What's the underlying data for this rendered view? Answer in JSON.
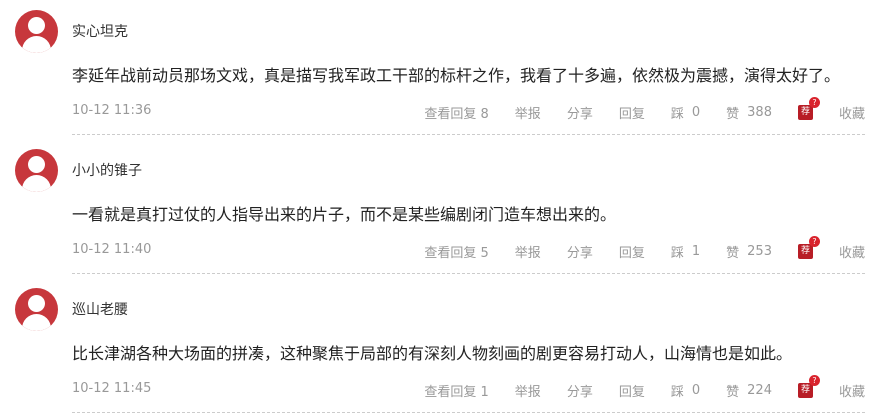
{
  "colors": {
    "avatar": "#c7373c",
    "recommend": "#b81d26",
    "meta_text": "#999999"
  },
  "comments": [
    {
      "username": "实心坦克",
      "content": "李延年战前动员那场文戏，真是描写我军政工干部的标杆之作，我看了十多遍，依然极为震撼，演得太好了。",
      "time": "10-12 11:36",
      "view_replies": "查看回复 8",
      "report": "举报",
      "share": "分享",
      "reply": "回复",
      "dislike_label": "踩",
      "dislike_count": "0",
      "like_label": "赞",
      "like_count": "388",
      "recommend": "荐",
      "recommend_badge": "?",
      "favorite": "收藏"
    },
    {
      "username": "小小的锥子",
      "content": "一看就是真打过仗的人指导出来的片子，而不是某些编剧闭门造车想出来的。",
      "time": "10-12 11:40",
      "view_replies": "查看回复 5",
      "report": "举报",
      "share": "分享",
      "reply": "回复",
      "dislike_label": "踩",
      "dislike_count": "1",
      "like_label": "赞",
      "like_count": "253",
      "recommend": "荐",
      "recommend_badge": "?",
      "favorite": "收藏"
    },
    {
      "username": "巡山老腰",
      "content": "比长津湖各种大场面的拼凑，这种聚焦于局部的有深刻人物刻画的剧更容易打动人，山海情也是如此。",
      "time": "10-12 11:45",
      "view_replies": "查看回复 1",
      "report": "举报",
      "share": "分享",
      "reply": "回复",
      "dislike_label": "踩",
      "dislike_count": "0",
      "like_label": "赞",
      "like_count": "224",
      "recommend": "荐",
      "recommend_badge": "?",
      "favorite": "收藏"
    }
  ]
}
